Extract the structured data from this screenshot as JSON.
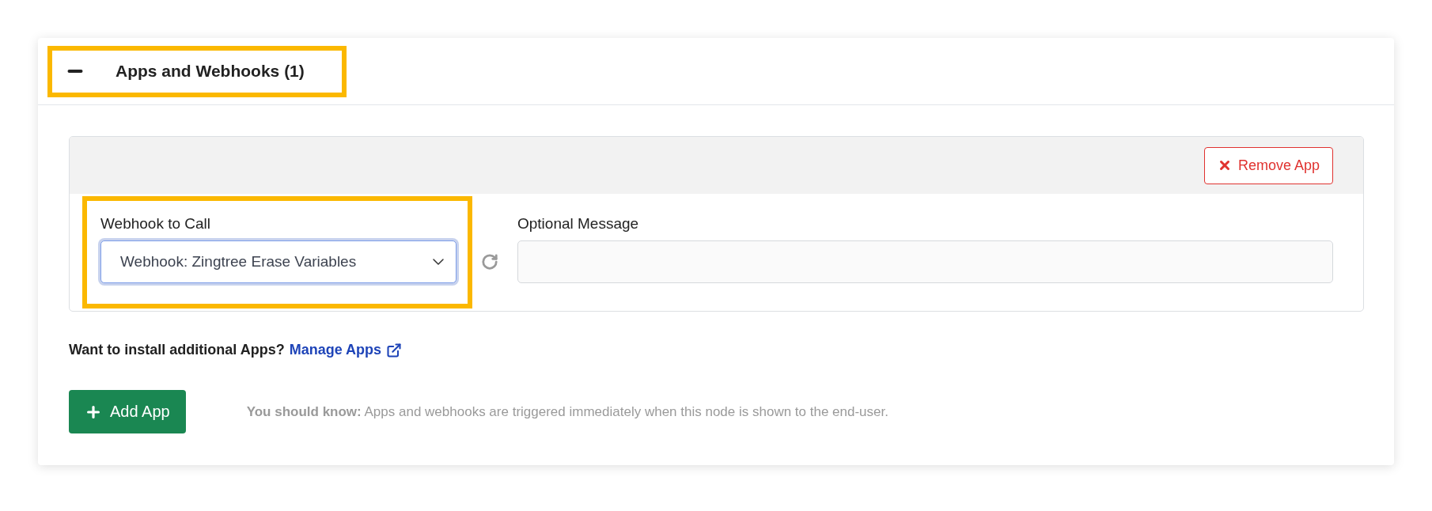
{
  "section": {
    "title": "Apps and Webhooks (1)",
    "expanded": true,
    "highlighted": true
  },
  "apps": [
    {
      "remove_button": "Remove App",
      "webhook": {
        "label": "Webhook to Call",
        "value": "Webhook: Zingtree Erase Variables",
        "highlighted": true
      },
      "message": {
        "label": "Optional Message"
      }
    }
  ],
  "install_prompt": {
    "text": "Want to install additional Apps?",
    "link": "Manage Apps"
  },
  "add_button": "Add App",
  "note": "**You should know:** Apps and webhooks are triggered immediately when this node is shown to the end-user."
}
